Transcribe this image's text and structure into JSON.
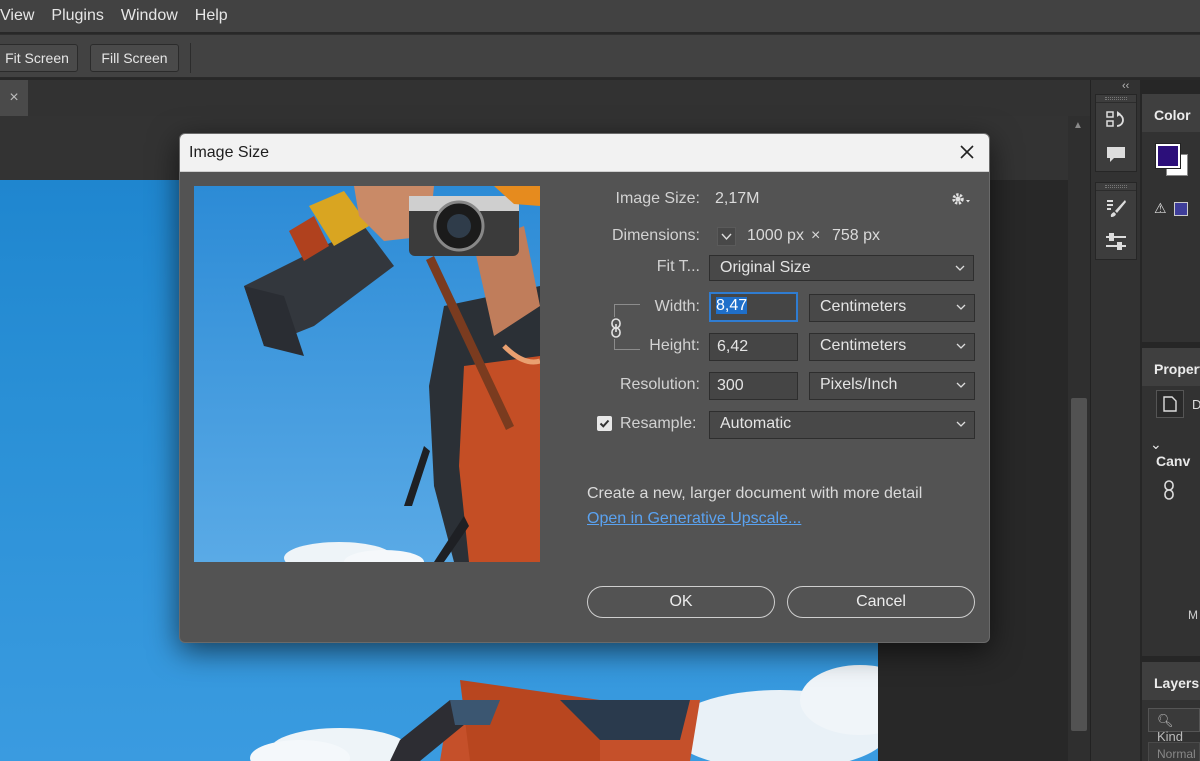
{
  "menubar": {
    "items": [
      "View",
      "Plugins",
      "Window",
      "Help"
    ]
  },
  "options": {
    "fit_screen": "Fit Screen",
    "fill_screen": "Fill Screen"
  },
  "tabbar": {
    "close_glyph": "×"
  },
  "panels": {
    "color_tab": "Color",
    "properties_tab": "Propert",
    "properties_doc_letter": "D",
    "canvas_section": "Canv",
    "mo_label": "M",
    "layers_tab": "Layers",
    "kind_placeholder": "Kind",
    "blend_mode": "Normal",
    "fg_color": "#2c0f7a",
    "bg_color": "#ffffff",
    "gamut_color": "#3f3e9a"
  },
  "dialog": {
    "title": "Image Size",
    "image_size_label": "Image Size:",
    "image_size_value": "2,17M",
    "dimensions_label": "Dimensions:",
    "dim_width": "1000 px",
    "dim_times": "×",
    "dim_height": "758 px",
    "fit_to_label": "Fit T...",
    "fit_to_value": "Original Size",
    "width_label": "Width:",
    "width_value": "8,47",
    "width_unit": "Centimeters",
    "height_label": "Height:",
    "height_value": "6,42",
    "height_unit": "Centimeters",
    "resolution_label": "Resolution:",
    "resolution_value": "300",
    "resolution_unit": "Pixels/Inch",
    "resample_label": "Resample:",
    "resample_checked": true,
    "resample_value": "Automatic",
    "upscale_text": "Create a new, larger document with more detail",
    "upscale_link": "Open in Generative Upscale...",
    "ok_label": "OK",
    "cancel_label": "Cancel"
  }
}
